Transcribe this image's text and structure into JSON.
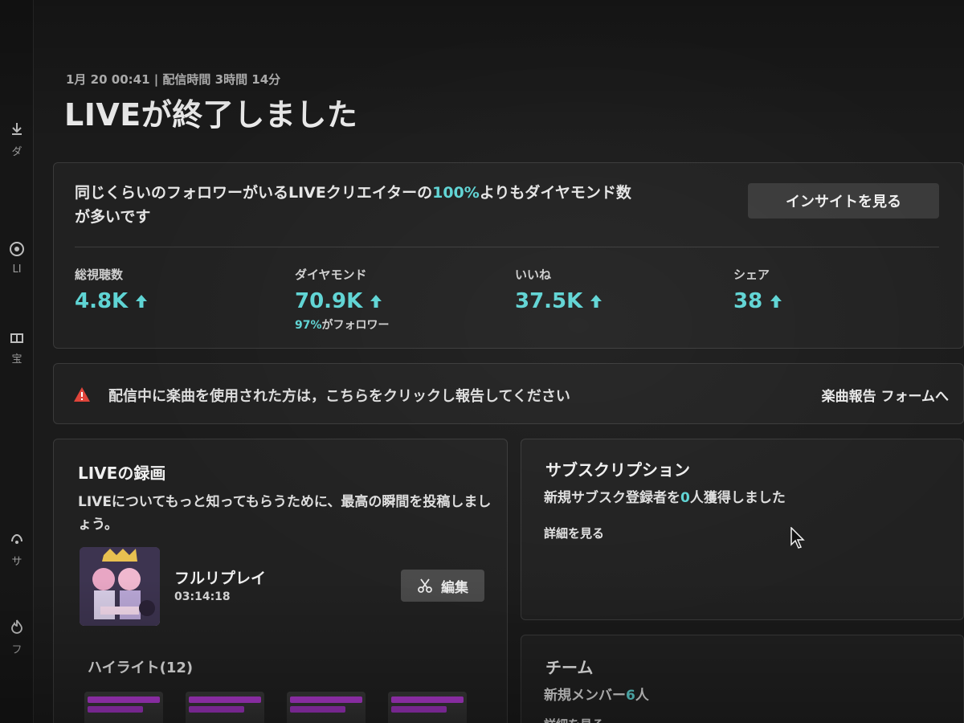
{
  "header": {
    "meta": "1月 20 00:41 | 配信時間 3時間 14分",
    "title": "LIVEが終了しました"
  },
  "sidebar": {
    "items": [
      {
        "icon": "download-icon",
        "label": "ダ"
      },
      {
        "icon": "target-icon",
        "label": "LI"
      },
      {
        "icon": "gift-icon",
        "label": "宝"
      },
      {
        "icon": "subscription-icon",
        "label": "サ"
      },
      {
        "icon": "flame-icon",
        "label": "フ"
      }
    ]
  },
  "insight": {
    "text_before": "同じくらいのフォロワーがいるLIVEクリエイターの",
    "highlight": "100%",
    "text_after": "よりもダイヤモンド数が多いです",
    "button_label": "インサイトを見る"
  },
  "stats": [
    {
      "label": "総視聴数",
      "value": "4.8K",
      "sub_pct": "",
      "sub_text": ""
    },
    {
      "label": "ダイヤモンド",
      "value": "70.9K",
      "sub_pct": "97%",
      "sub_text": "がフォロワー"
    },
    {
      "label": "いいね",
      "value": "37.5K",
      "sub_pct": "",
      "sub_text": ""
    },
    {
      "label": "シェア",
      "value": "38",
      "sub_pct": "",
      "sub_text": ""
    }
  ],
  "notice": {
    "text": "配信中に楽曲を使用された方は，こちらをクリックし報告してください",
    "link": "楽曲報告 フォームへ"
  },
  "recording": {
    "heading": "LIVEの録画",
    "description": "LIVEについてもっと知ってもらうために、最高の瞬間を投稿しましょう。",
    "replay_title": "フルリプレイ",
    "replay_duration": "03:14:18",
    "edit_label": "編集",
    "highlights_label": "ハイライト(12)"
  },
  "subscription": {
    "heading": "サブスクリプション",
    "text_before": "新規サブスク登録者を",
    "count": "0",
    "text_after": "人獲得しました",
    "details_link": "詳細を見る"
  },
  "team": {
    "heading": "チーム",
    "text_before": "新規メンバー",
    "count": "6",
    "text_after": "人",
    "details_link": "詳細を見る"
  },
  "colors": {
    "accent": "#5fd4d4",
    "warning": "#e0443a",
    "background": "#1b1b1b",
    "card": "#212121"
  }
}
